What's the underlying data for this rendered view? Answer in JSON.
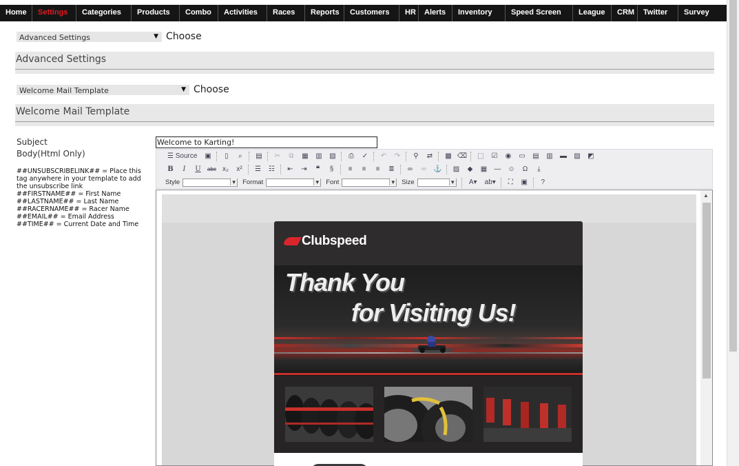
{
  "nav": {
    "items": [
      "Home",
      "Settings",
      "Categories",
      "Products",
      "Combo",
      "Activities",
      "Races",
      "Reports",
      "Customers",
      "HR",
      "Alerts",
      "Inventory",
      "Speed Screen",
      "League",
      "CRM",
      "Twitter",
      "Survey"
    ],
    "active": "Settings",
    "active_color": "#e21a22",
    "bar_color": "#151515"
  },
  "settings_select": {
    "value": "Advanced Settings",
    "choose_label": "Choose"
  },
  "advanced_section": {
    "title": "Advanced Settings"
  },
  "template_select": {
    "value": "Welcome Mail Template",
    "choose_label": "Choose"
  },
  "template_section": {
    "title": "Welcome Mail Template"
  },
  "form": {
    "subject_label": "Subject",
    "subject_value": "Welcome to Karting!",
    "body_label": "Body(Html Only)",
    "help_lines": [
      "##UNSUBSCRIBELINK## = Place this tag anywhere in your template to add the unsubscribe link",
      "##FIRSTNAME## = First Name",
      "##LASTNAME## = Last Name",
      "##RACERNAME## = Racer Name",
      "##EMAIL## = Email Address",
      "##TIME## = Current Date and Time"
    ]
  },
  "toolbar": {
    "source_label": "Source",
    "style_label": "Style",
    "format_label": "Format",
    "font_label": "Font",
    "size_label": "Size"
  },
  "email_preview": {
    "brand": "Clubspeed",
    "headline_1": "Thank You",
    "headline_2": "for Visiting Us!",
    "brand_color": "#d8262c"
  }
}
